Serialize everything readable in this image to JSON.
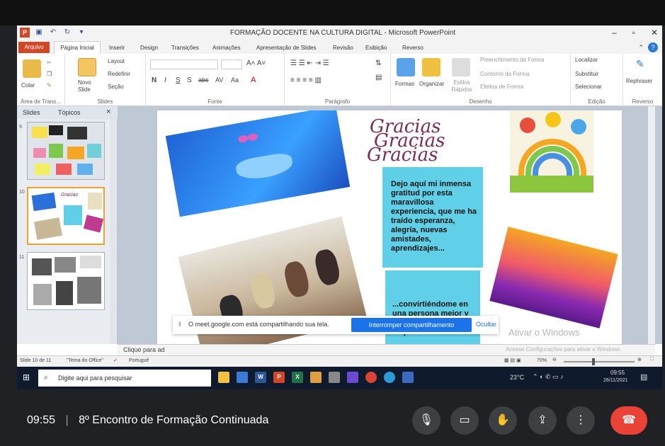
{
  "window": {
    "title": "FORMAÇÃO DOCENTE NA CULTURA DIGITAL - Microsoft PowerPoint"
  },
  "ribbon_tabs": [
    "Arquivo",
    "Página Inicial",
    "Inserir",
    "Design",
    "Transições",
    "Animações",
    "Apresentação de Slides",
    "Revisão",
    "Exibição",
    "Reverso"
  ],
  "ribbon": {
    "groups": [
      "Área de Trans...",
      "Slides",
      "Fonte",
      "Parágrafo",
      "Desenho",
      "Edição",
      "Reverso"
    ],
    "buttons": {
      "paste": "Colar",
      "new_slide": "Novo Slide",
      "layout": "Layout",
      "reset": "Redefinir",
      "section": "Seção",
      "shapes": "Formas",
      "arrange": "Organizar",
      "quick_styles": "Estilos Rápidos",
      "shape_fill": "Preenchimento da Forma",
      "shape_outline": "Contorno da Forma",
      "shape_effects": "Efeitos de Forma",
      "find": "Localizar",
      "replace": "Substituir",
      "select": "Selecionar",
      "rephrase": "Rephraser"
    }
  },
  "slides_panel": {
    "tabs": [
      "Slides",
      "Tópicos"
    ],
    "close": "×",
    "thumbnails": [
      {
        "number": "9"
      },
      {
        "number": "10"
      },
      {
        "number": "11"
      }
    ]
  },
  "slide": {
    "gracias": [
      "Gracias",
      "Gracias",
      "Gracias"
    ],
    "text1": "Dejo aquí mi inmensa gratitud por esta maravillosa experiencia, que me ha traído esperanza, alegría, nuevas amistades, aprendizajes...",
    "text2": "...convirtiéndome en una persona mejor y más capacitada para mi profesión."
  },
  "notes_placeholder": "Clique para ad",
  "status": {
    "slide": "Slide 10 de 11",
    "theme": "\"Tema do Office\"",
    "language": "Portuguê",
    "zoom": "70%"
  },
  "share_bar": {
    "message": "O meet.google.com está compartilhando sua tela.",
    "stop": "Interromper compartilhamento",
    "hide": "Ocultar"
  },
  "watermark": {
    "line1": "Ativar o Windows",
    "line2": "Acesse Configurações para ativar o Windows."
  },
  "taskbar": {
    "search_placeholder": "Digite aqui para pesquisar",
    "weather": "23°C",
    "time": "09:55",
    "date": "26/11/2021"
  },
  "meet": {
    "time": "09:55",
    "separator": "|",
    "title": "8º Encontro de Formação Continuada"
  },
  "colors": {
    "ppt_accent": "#d24726",
    "meet_bg": "#202124",
    "meet_end": "#ea4335",
    "share_button": "#1a73e8",
    "text_box": "#5fd0e8"
  }
}
